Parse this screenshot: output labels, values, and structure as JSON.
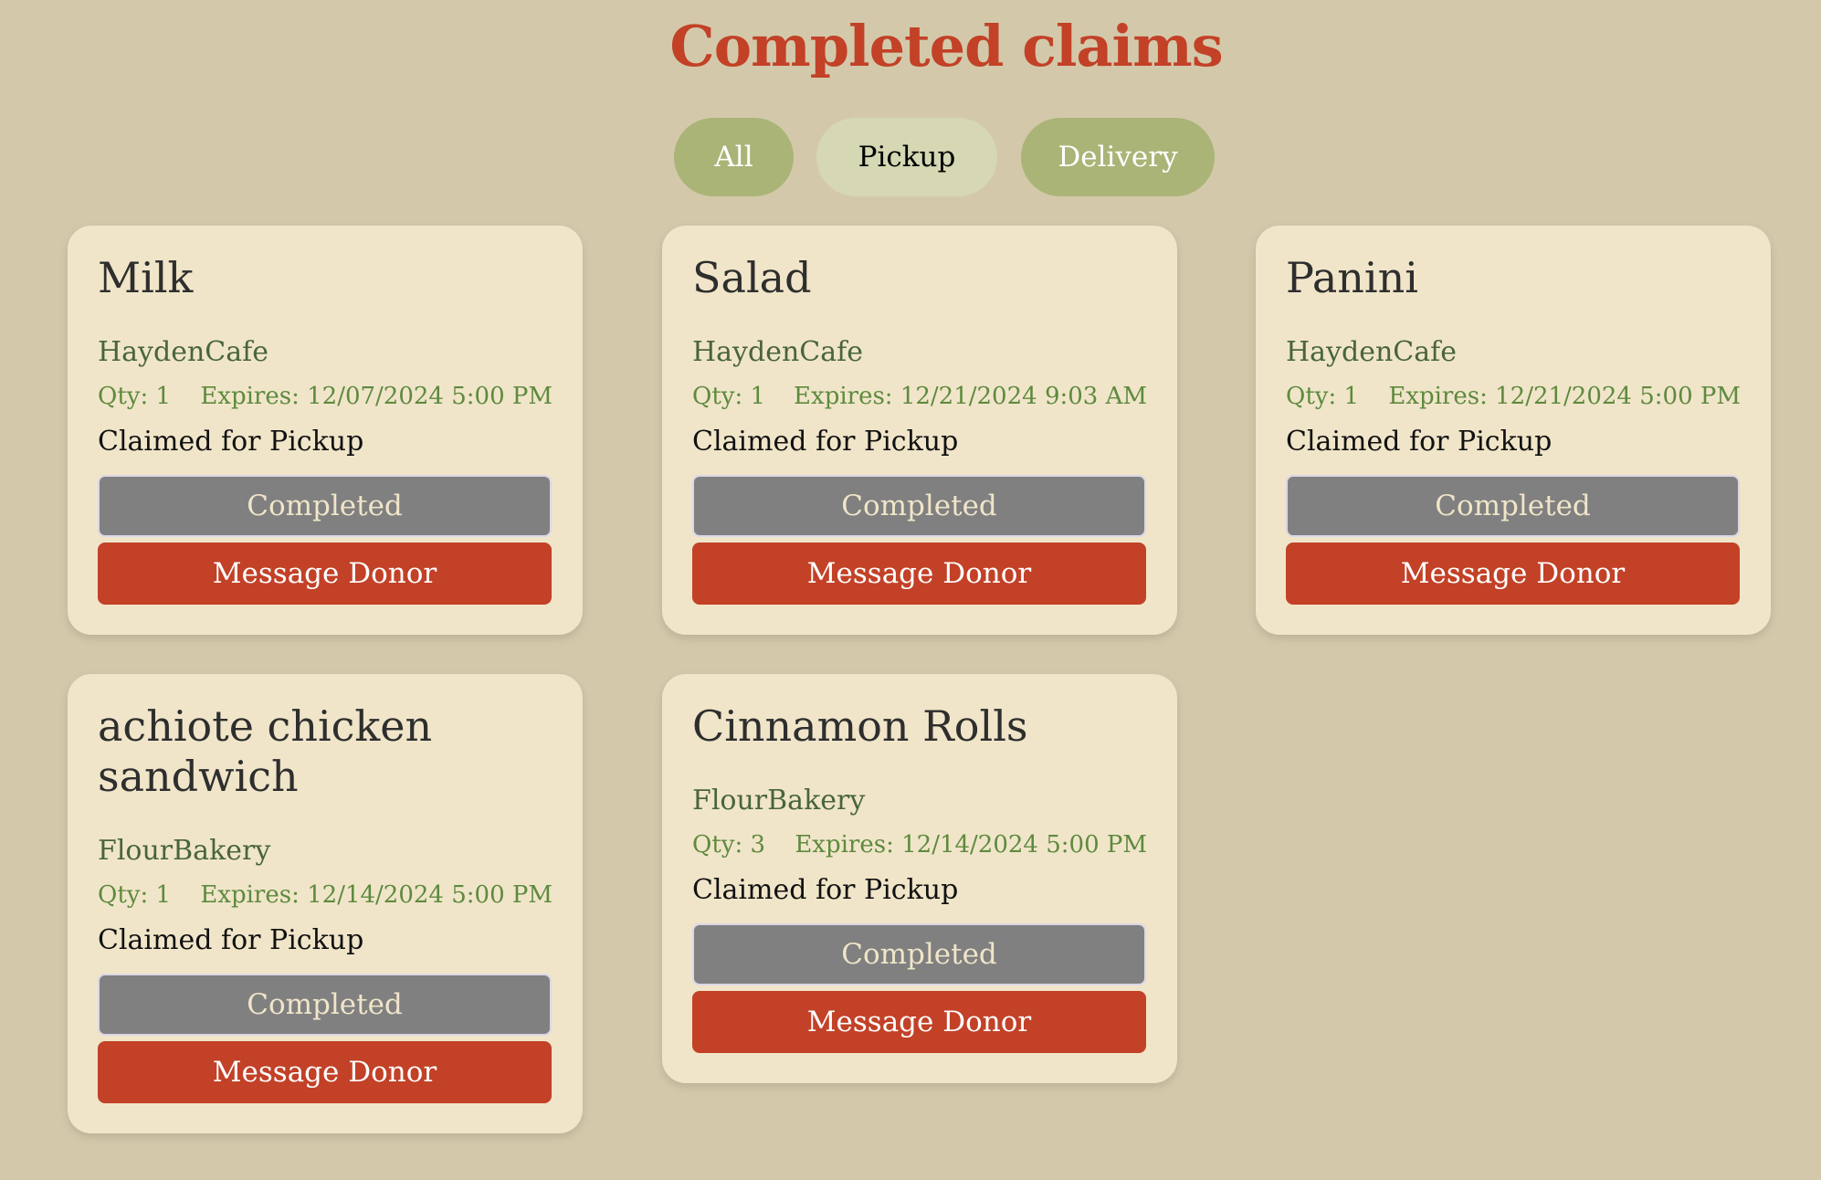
{
  "page": {
    "title": "Completed claims"
  },
  "filters": {
    "all": "All",
    "pickup": "Pickup",
    "delivery": "Delivery",
    "selected": "Pickup"
  },
  "colors": {
    "background": "#d3c9aa",
    "card": "#f0e5c9",
    "accent": "#c24127",
    "filter_inactive": "#aab477",
    "filter_active": "#d6d7b3",
    "completed_button": "#808080",
    "donor_text": "#496538",
    "meta_text": "#5e8a3e"
  },
  "claims": [
    {
      "name": "Milk",
      "donor": "HaydenCafe",
      "qty": "Qty: 1",
      "expires": "Expires: 12/07/2024 5:00 PM",
      "status": "Claimed for Pickup",
      "completed_label": "Completed",
      "message_label": "Message Donor"
    },
    {
      "name": "Salad",
      "donor": "HaydenCafe",
      "qty": "Qty: 1",
      "expires": "Expires: 12/21/2024 9:03 AM",
      "status": "Claimed for Pickup",
      "completed_label": "Completed",
      "message_label": "Message Donor"
    },
    {
      "name": "Panini",
      "donor": "HaydenCafe",
      "qty": "Qty: 1",
      "expires": "Expires: 12/21/2024 5:00 PM",
      "status": "Claimed for Pickup",
      "completed_label": "Completed",
      "message_label": "Message Donor"
    },
    {
      "name": "achiote chicken sandwich",
      "donor": "FlourBakery",
      "qty": "Qty: 1",
      "expires": "Expires: 12/14/2024 5:00 PM",
      "status": "Claimed for Pickup",
      "completed_label": "Completed",
      "message_label": "Message Donor"
    },
    {
      "name": "Cinnamon Rolls",
      "donor": "FlourBakery",
      "qty": "Qty: 3",
      "expires": "Expires: 12/14/2024 5:00 PM",
      "status": "Claimed for Pickup",
      "completed_label": "Completed",
      "message_label": "Message Donor"
    }
  ]
}
